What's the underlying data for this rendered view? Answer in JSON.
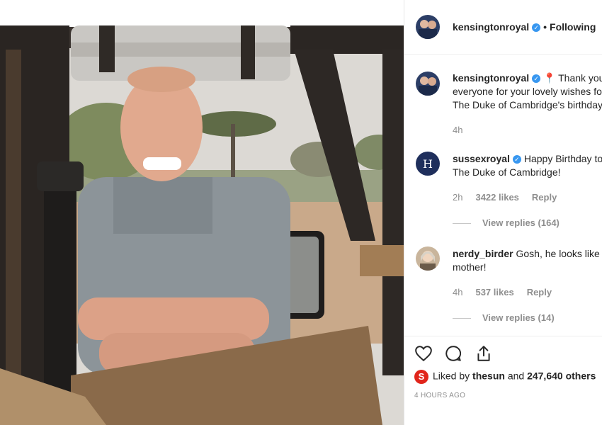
{
  "post": {
    "author": "kensingtonroyal",
    "follow_label": "Following",
    "separator": "•"
  },
  "comments": [
    {
      "username": "kensingtonroyal",
      "verified": true,
      "text": "📍 Thank you everyone for your lovely wishes for The Duke of Cambridge's birthday",
      "time": "4h"
    },
    {
      "username": "sussexroyal",
      "verified": true,
      "text": "Happy Birthday to The Duke of Cambridge!",
      "time": "2h",
      "likes": "3422 likes",
      "reply_label": "Reply",
      "view_replies": "View replies (164)"
    },
    {
      "username": "nerdy_birder",
      "verified": false,
      "text": "Gosh, he looks like his mother!",
      "time": "4h",
      "likes": "537 likes",
      "reply_label": "Reply",
      "view_replies": "View replies (14)"
    }
  ],
  "likes_line": {
    "prefix": "Liked by",
    "user": "thesun",
    "conjunction": "and",
    "count_text": "247,640 others"
  },
  "posted_ago": "4 HOURS AGO",
  "icons": {
    "like": "heart-icon",
    "comment": "comment-icon",
    "share": "share-icon",
    "verified": "verified-badge-icon",
    "location": "location-pin-icon"
  },
  "colors": {
    "verified": "#3897f0",
    "muted": "#8e8e8e",
    "text": "#262626",
    "thesun_red": "#e1251b"
  }
}
